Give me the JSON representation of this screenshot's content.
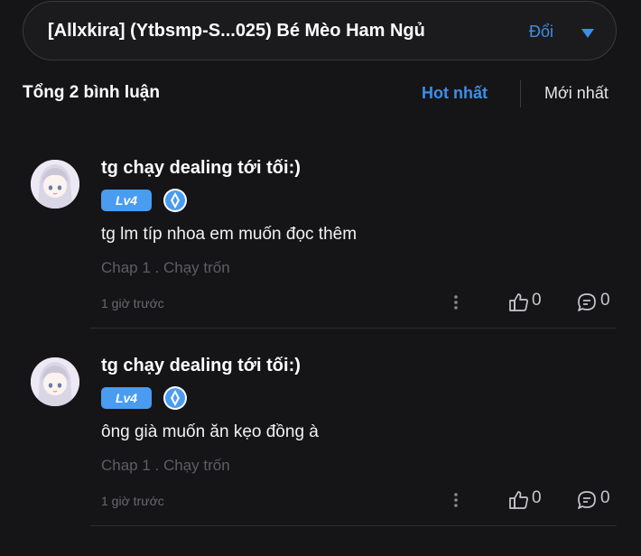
{
  "header": {
    "chapter_title": "[Allxkira] (Ytbsmp-S...025) Bé Mèo Ham Ngủ",
    "change_label": "Đổi"
  },
  "comments_header": {
    "total_label": "Tổng 2 bình luận",
    "sort_hot": "Hot nhất",
    "sort_new": "Mới nhất"
  },
  "comments": [
    {
      "username": "tg chạy dealing tới tối:)",
      "level": "Lv4",
      "content": "tg lm típ nhoa em muốn đọc thêm",
      "chapter": "Chap 1 . Chạy trốn",
      "time": "1 giờ trước",
      "likes": "0",
      "replies": "0"
    },
    {
      "username": "tg chạy dealing tới tối:)",
      "level": "Lv4",
      "content": "ông già muốn ăn kẹo đồng à",
      "chapter": "Chap 1 . Chạy trốn",
      "time": "1 giờ trước",
      "likes": "0",
      "replies": "0"
    }
  ],
  "colors": {
    "background": "#151517",
    "accent": "#3d8ee8",
    "level_badge": "#4a9cf0",
    "muted_text": "#5e5e63"
  },
  "icons": {
    "dropdown": "chevron-down-icon",
    "honor": "honor-badge-icon",
    "more": "more-vertical-icon",
    "like": "thumbs-up-icon",
    "reply": "comment-bubble-icon"
  }
}
